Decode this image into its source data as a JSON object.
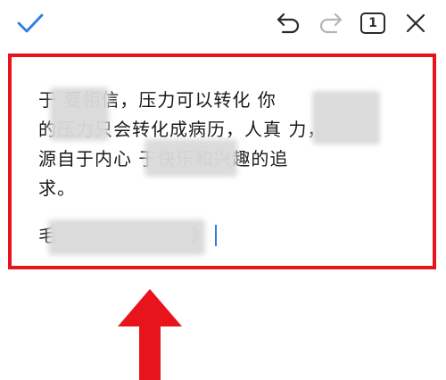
{
  "toolbar": {
    "done_icon": "check-icon",
    "undo_icon": "undo-icon",
    "redo_icon": "redo-icon",
    "page_count": "1",
    "close_icon": "close-icon"
  },
  "note": {
    "lines": [
      "于    要相信，压力可以转化    你",
      "的压力只会转化成病历，人真     力，",
      "源自于内心         于快乐和兴趣的追",
      "求。"
    ],
    "signature_start": "毛",
    "signature_end": "》"
  },
  "colors": {
    "accent_check": "#2f7de1",
    "frame_red": "#e8141b",
    "arrow_red": "#e8141b",
    "caret_blue": "#2f7de1",
    "icon_dark": "#2b2b2b",
    "icon_disabled": "#b5b5b5"
  }
}
